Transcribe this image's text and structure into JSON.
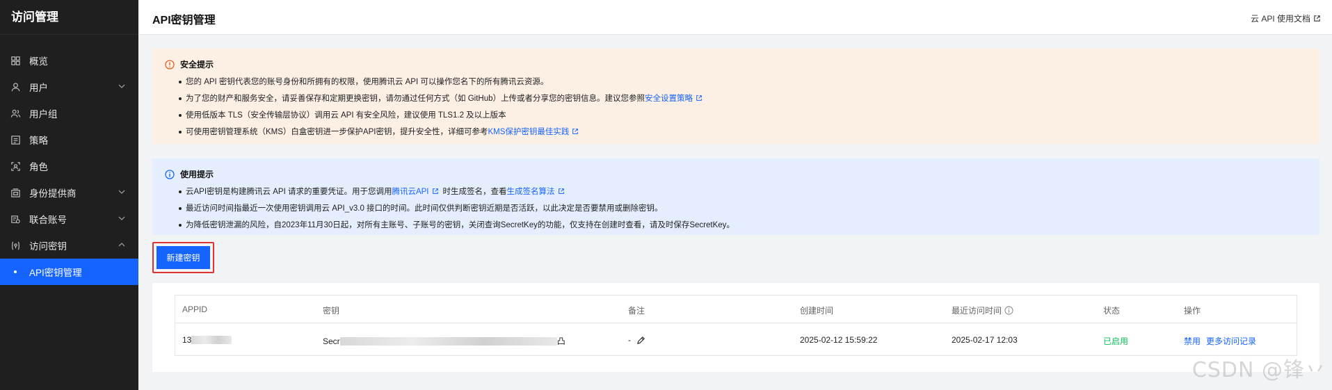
{
  "sidebar": {
    "title": "访问管理",
    "items": [
      {
        "label": "概览",
        "icon": "grid-icon"
      },
      {
        "label": "用户",
        "icon": "user-icon",
        "chevron": "down"
      },
      {
        "label": "用户组",
        "icon": "user-group-icon"
      },
      {
        "label": "策略",
        "icon": "policy-icon"
      },
      {
        "label": "角色",
        "icon": "role-icon"
      },
      {
        "label": "身份提供商",
        "icon": "identity-provider-icon",
        "chevron": "down"
      },
      {
        "label": "联合账号",
        "icon": "federated-account-icon",
        "chevron": "down"
      },
      {
        "label": "访问密钥",
        "icon": "access-key-icon",
        "chevron": "up"
      },
      {
        "label": "API密钥管理",
        "active": true
      }
    ]
  },
  "header": {
    "title": "API密钥管理",
    "doc_link": "云 API 使用文档"
  },
  "security_notice": {
    "title": "安全提示",
    "items": [
      {
        "text": "您的 API 密钥代表您的账号身份和所拥有的权限，使用腾讯云 API 可以操作您名下的所有腾讯云资源。"
      },
      {
        "text": "为了您的财产和服务安全，请妥善保存和定期更换密钥，请勿通过任何方式（如 GitHub）上传或者分享您的密钥信息。建议您参照",
        "link": "安全设置策略"
      },
      {
        "text": "使用低版本 TLS（安全传输层协议）调用云 API 有安全风险，建议使用 TLS1.2 及以上版本"
      },
      {
        "text": "可使用密钥管理系统（KMS）白盒密钥进一步保护API密钥，提升安全性，详细可参考",
        "link": "KMS保护密钥最佳实践"
      }
    ]
  },
  "usage_notice": {
    "title": "使用提示",
    "items": [
      {
        "text": "云API密钥是构建腾讯云 API 请求的重要凭证。用于您调用",
        "link": "腾讯云API",
        "text2": "时生成签名，查看",
        "link2": "生成签名算法"
      },
      {
        "text": "最近访问时间指最近一次使用密钥调用云 API_v3.0 接口的时间。此时间仅供判断密钥近期是否活跃，以此决定是否要禁用或删除密钥。"
      },
      {
        "text": "为降低密钥泄漏的风险，自2023年11月30日起，对所有主账号、子账号的密钥，关闭查询SecretKey的功能，仅支持在创建时查看，请及时保存SecretKey。"
      }
    ]
  },
  "create_button": "新建密钥",
  "table": {
    "columns": [
      "APPID",
      "密钥",
      "备注",
      "创建时间",
      "最近访问时间",
      "状态",
      "操作"
    ],
    "rows": [
      {
        "appid_prefix": "13",
        "key_prefix": "Secr",
        "key_suffix": "凸",
        "remark": "-",
        "created": "2025-02-12 15:59:22",
        "last_access": "2025-02-17 12:03",
        "status": "已启用",
        "actions": [
          "禁用",
          "更多访问记录"
        ]
      }
    ]
  },
  "watermark": "CSDN @锋丷",
  "colors": {
    "accent": "#1664ff",
    "status_enabled": "#0abf5b",
    "warn_bg": "#fcefe4",
    "info_bg": "#e5eefc",
    "highlight": "#e03131"
  }
}
